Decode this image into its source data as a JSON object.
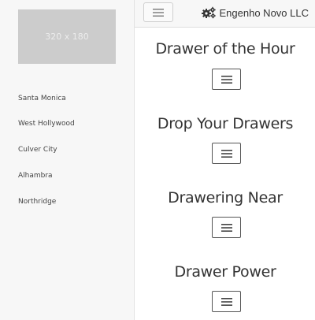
{
  "sidebar": {
    "image_label": "320 x 180",
    "items": [
      {
        "label": "Santa Monica"
      },
      {
        "label": "West Hollywood"
      },
      {
        "label": "Culver City"
      },
      {
        "label": "Alhambra"
      },
      {
        "label": "Northridge"
      }
    ]
  },
  "topbar": {
    "menu_icon": "hamburger-icon",
    "brand_icon": "gears-icon",
    "brand_label": "Engenho Novo LLC"
  },
  "sections": [
    {
      "title": "Drawer of the Hour"
    },
    {
      "title": "Drop Your Drawers"
    },
    {
      "title": "Drawering Near"
    },
    {
      "title": "Drawer Power"
    }
  ],
  "colors": {
    "sidebar_bg": "#f7f7f7",
    "placeholder_bg": "#cccccc",
    "text": "#333333"
  }
}
